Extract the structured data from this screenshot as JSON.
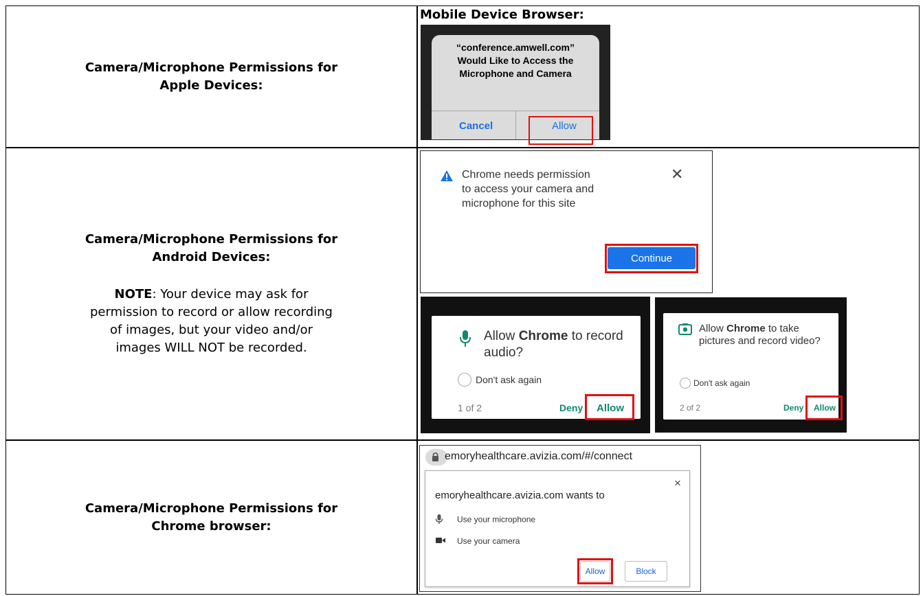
{
  "rows": [
    {
      "title_lines": [
        "Camera/Microphone Permissions for",
        "Apple Devices:"
      ],
      "section_label": "Mobile Device Browser:",
      "ios_dialog": {
        "message_lines": [
          "“conference.amwell.com”",
          "Would Like to Access the",
          "Microphone and Camera"
        ],
        "cancel": "Cancel",
        "allow": "Allow"
      }
    },
    {
      "title_lines": [
        "Camera/Microphone Permissions for",
        "Android Devices:"
      ],
      "note": {
        "label": "NOTE",
        "text_lines": [
          ": Your device may ask for",
          "permission to record or allow recording",
          "of images, but your video and/or",
          "images WILL NOT be recorded."
        ]
      },
      "chrome_prompt": {
        "message_lines": [
          "Chrome needs permission",
          "to access your camera and",
          "microphone for this site"
        ],
        "continue": "Continue",
        "close": "✕"
      },
      "android_prompts": [
        {
          "pre": "Allow ",
          "app": "Chrome",
          "post": " to record audio?",
          "checkbox": "Don't ask again",
          "step": "1 of 2",
          "deny": "Deny",
          "allow": "Allow",
          "icon": "microphone-icon"
        },
        {
          "pre": "Allow ",
          "app": "Chrome",
          "post": " to take pictures and record video?",
          "checkbox": "Don't ask again",
          "step": "2 of 2",
          "deny": "Deny",
          "allow": "Allow",
          "icon": "camera-icon"
        }
      ]
    },
    {
      "title_lines": [
        "Camera/Microphone Permissions for",
        "Chrome browser:"
      ],
      "desktop": {
        "url": "emoryhealthcare.avizia.com/#/connect",
        "close": "×",
        "heading": "emoryhealthcare.avizia.com wants to",
        "permissions": [
          "Use your microphone",
          "Use your camera"
        ],
        "allow": "Allow",
        "block": "Block"
      }
    }
  ],
  "colors": {
    "highlight": "#e01010",
    "ios_blue": "#1a6fe0",
    "chrome_blue": "#1a73e8",
    "android_green": "#0f8a6e"
  }
}
